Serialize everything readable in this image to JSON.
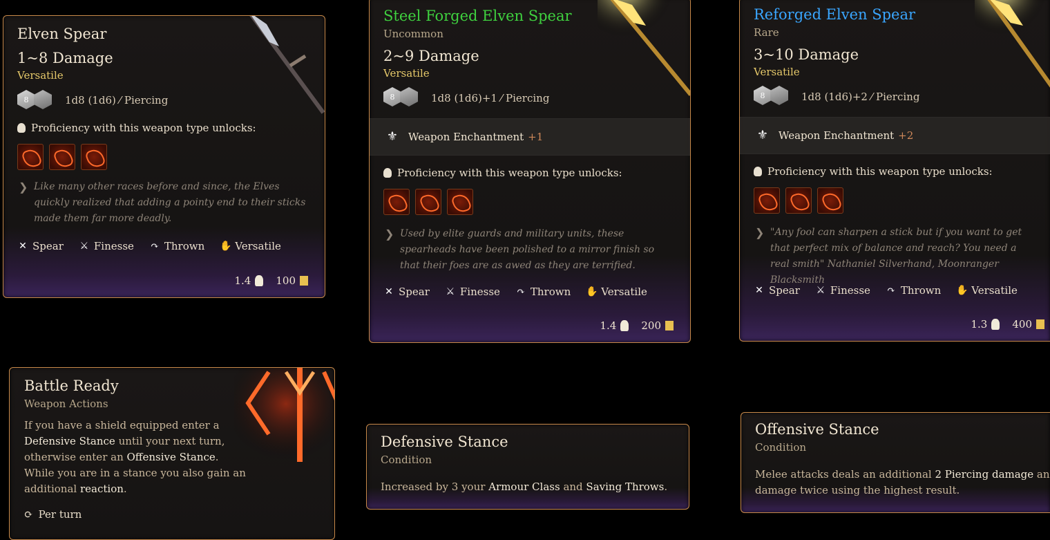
{
  "cards": {
    "elven_spear": {
      "title": "Elven Spear",
      "damage": "1~8 Damage",
      "property": "Versatile",
      "dice_text": "1d8 (1d6)",
      "damage_type": "Piercing",
      "proficiency": "Proficiency with this weapon type unlocks:",
      "flavor": "Like many other races before and since, the Elves quickly realized that adding a pointy end to their sticks made them far more deadly.",
      "traits": [
        "Spear",
        "Finesse",
        "Thrown",
        "Versatile"
      ],
      "weight": "1.4",
      "value": "100"
    },
    "steel_forged": {
      "title": "Steel Forged Elven Spear",
      "rarity": "Uncommon",
      "damage": "2~9 Damage",
      "property": "Versatile",
      "dice_text": "1d8 (1d6)+1",
      "damage_type": "Piercing",
      "enchant_label": "Weapon Enchantment",
      "enchant_bonus": "+1",
      "proficiency": "Proficiency with this weapon type unlocks:",
      "flavor": "Used by elite guards and military units, these spearheads have been polished to a mirror finish so that their foes are as awed as they are terrified.",
      "traits": [
        "Spear",
        "Finesse",
        "Thrown",
        "Versatile"
      ],
      "weight": "1.4",
      "value": "200"
    },
    "reforged": {
      "title": "Reforged Elven Spear",
      "rarity": "Rare",
      "damage": "3~10 Damage",
      "property": "Versatile",
      "dice_text": "1d8 (1d6)+2",
      "damage_type": "Piercing",
      "enchant_label": "Weapon Enchantment",
      "enchant_bonus": "+2",
      "proficiency": "Proficiency with this weapon type unlocks:",
      "flavor": "\"Any fool can sharpen a stick but if you want to get that perfect mix of balance and reach? You need a real smith\" Nathaniel Silverhand, Moonranger Blacksmith",
      "traits": [
        "Spear",
        "Finesse",
        "Thrown",
        "Versatile"
      ],
      "weight": "1.3",
      "value": "400"
    },
    "battle_ready": {
      "title": "Battle Ready",
      "subtitle": "Weapon Actions",
      "line1": "If you have a shield equipped enter a",
      "kw_defensive": "Defensive Stance",
      "line2b": " until your next turn,",
      "line3a": "otherwise enter an ",
      "kw_offensive": "Offensive Stance",
      "line3b": ".",
      "line4": "While you are in a stance you also gain an",
      "line5a": "additional ",
      "kw_reaction": "reaction",
      "line5b": ".",
      "per_turn": "Per turn"
    },
    "defensive_stance": {
      "title": "Defensive Stance",
      "subtitle": "Condition",
      "text_a": "Increased by 3 your ",
      "kw_ac": "Armour Class",
      "text_b": " and ",
      "kw_saves": "Saving Throws",
      "text_c": "."
    },
    "offensive_stance": {
      "title": "Offensive Stance",
      "subtitle": "Condition",
      "text_a": "Melee attacks deals an additional ",
      "kw_piercing": "2 Piercing damage",
      "text_b": " and roll",
      "text_c": "damage twice using the highest result."
    }
  },
  "colors": {
    "uncommon": "#3fd13f",
    "rare": "#3aa6ff",
    "border": "#c98a4a",
    "versatile": "#e6c96a"
  }
}
